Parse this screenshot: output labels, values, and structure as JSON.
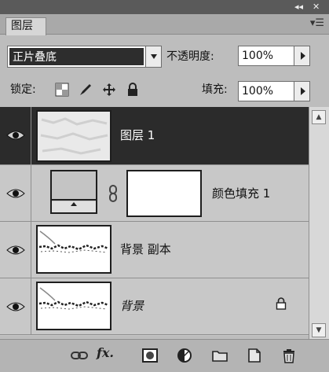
{
  "panel": {
    "collapse_icon": "double-chevron-icon",
    "close_icon": "close-icon",
    "tab_label": "图层",
    "menu_icon": "panel-menu-icon"
  },
  "blend": {
    "mode": "正片叠底"
  },
  "opacity": {
    "label": "不透明度:",
    "value": "100%"
  },
  "lock": {
    "label": "锁定:",
    "icons": [
      "lock-transparent-pixels-icon",
      "lock-image-pixels-icon",
      "lock-position-icon",
      "lock-all-icon"
    ]
  },
  "fill": {
    "label": "填充:",
    "value": "100%"
  },
  "layers": [
    {
      "name": "图层 1",
      "selected": true,
      "visible": true
    },
    {
      "name": "颜色填充 1",
      "selected": false,
      "visible": true,
      "type": "fill-adjustment",
      "linked": true
    },
    {
      "name": "背景 副本",
      "selected": false,
      "visible": true
    },
    {
      "name": "背景",
      "selected": false,
      "visible": true,
      "italic": true,
      "locked": true
    }
  ],
  "toolbar_icons": [
    "link-layers-icon",
    "fx-layer-style-icon",
    "add-mask-icon",
    "new-adjustment-layer-icon",
    "new-group-folder-icon",
    "new-layer-icon",
    "delete-trash-icon"
  ],
  "toolbar_fx_text": "fx.",
  "colors": {
    "selected_row": "#2b2b2b",
    "panel_bg": "#bdbdbd",
    "fill_swatch": "#c4c4c4"
  }
}
